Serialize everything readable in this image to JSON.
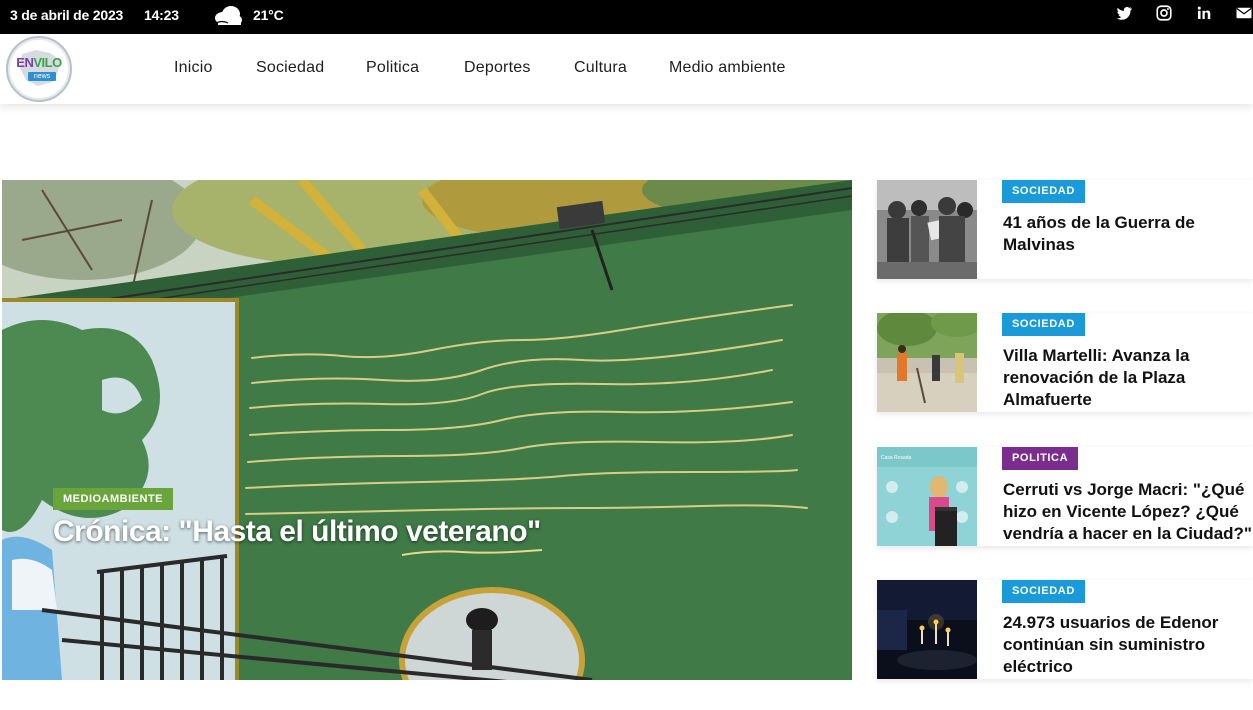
{
  "topbar": {
    "date": "3 de abril de 2023",
    "time": "14:23",
    "weather_icon": "cloud-icon",
    "temperature": "21°C",
    "social_icons": [
      "twitter-icon",
      "instagram-icon",
      "linkedin-icon",
      "mail-icon"
    ]
  },
  "logo": {
    "part1": "EN",
    "part2": "VILO",
    "sub": "news"
  },
  "nav": {
    "items": [
      "Inicio",
      "Sociedad",
      "Politica",
      "Deportes",
      "Cultura",
      "Medio ambiente"
    ]
  },
  "hero": {
    "category": "MEDIOAMBIENTE",
    "category_color": "#6aa53c",
    "title": "Crónica: \"Hasta el último veterano\""
  },
  "sidebar": {
    "articles": [
      {
        "category": "SOCIEDAD",
        "category_color": "#1a9ad9",
        "title": "41 años de la Guerra de Malvinas"
      },
      {
        "category": "SOCIEDAD",
        "category_color": "#1a9ad9",
        "title": "Villa Martelli: Avanza la renovación de la Plaza Almafuerte"
      },
      {
        "category": "POLITICA",
        "category_color": "#7b2d8e",
        "title": "Cerruti vs Jorge Macri: \"¿Qué hizo en Vicente López? ¿Qué vendría a hacer en la Ciudad?\""
      },
      {
        "category": "SOCIEDAD",
        "category_color": "#1a9ad9",
        "title": "24.973 usuarios de Edenor continúan sin suministro eléctrico"
      }
    ]
  }
}
